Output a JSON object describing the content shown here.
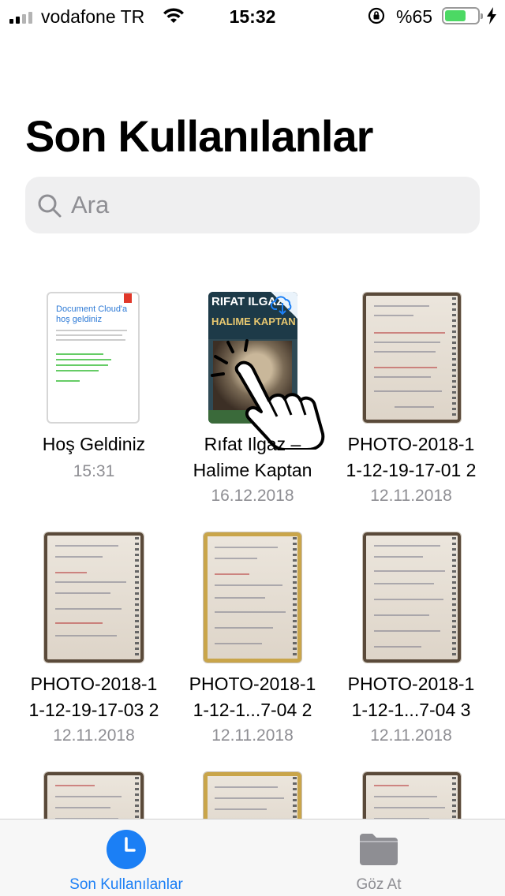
{
  "status_bar": {
    "carrier": "vodafone TR",
    "time": "15:32",
    "battery_percent": "%65",
    "battery_level": 0.65
  },
  "page": {
    "title": "Son Kullanılanlar"
  },
  "search": {
    "placeholder": "Ara"
  },
  "files": [
    {
      "name_line1": "Hoş Geldiniz",
      "name_line2": "",
      "date": "15:31"
    },
    {
      "name_line1": "Rıfat Ilgaz –",
      "name_line2": "Halime Kaptan",
      "date": "16.12.2018"
    },
    {
      "name_line1": "PHOTO-2018-1",
      "name_line2": "1-12-19-17-01 2",
      "date": "12.11.2018"
    },
    {
      "name_line1": "PHOTO-2018-1",
      "name_line2": "1-12-19-17-03 2",
      "date": "12.11.2018"
    },
    {
      "name_line1": "PHOTO-2018-1",
      "name_line2": "1-12-1...7-04 2",
      "date": "12.11.2018"
    },
    {
      "name_line1": "PHOTO-2018-1",
      "name_line2": "1-12-1...7-04 3",
      "date": "12.11.2018"
    }
  ],
  "welcome_doc": {
    "heading": "Document Cloud'a hoş geldiniz"
  },
  "book_cover": {
    "title_top": "RIFAT ILGAZ",
    "title_main": "HALIME KAPTAN"
  },
  "tab_bar": {
    "recent_label": "Son Kullanılanlar",
    "browse_label": "Göz At"
  },
  "colors": {
    "accent": "#1b7ff5",
    "battery": "#4cd964",
    "secondary_text": "#8e8e93"
  }
}
